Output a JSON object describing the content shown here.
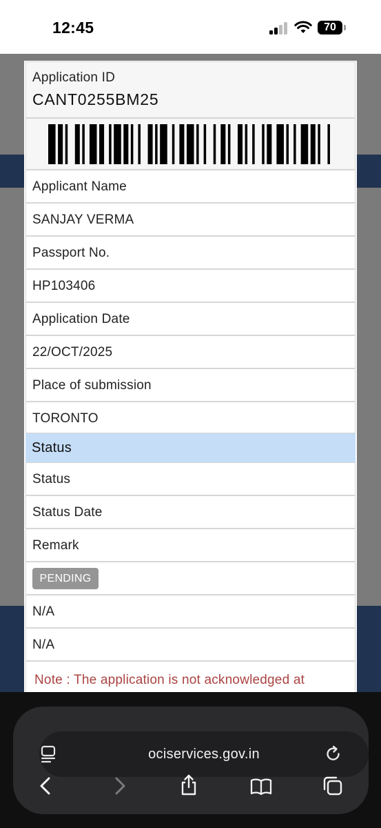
{
  "status_bar": {
    "time": "12:45",
    "battery": "70",
    "icons": [
      "cellular-signal-icon",
      "wifi-icon",
      "battery-icon"
    ]
  },
  "application": {
    "id_label": "Application ID",
    "id_value": "CANT0255BM25",
    "rows": [
      {
        "label": "Applicant Name",
        "value": "SANJAY VERMA"
      },
      {
        "label": "Passport No.",
        "value": "HP103406"
      },
      {
        "label": "Application Date",
        "value": "22/OCT/2025"
      },
      {
        "label": "Place of submission",
        "value": "TORONTO"
      }
    ]
  },
  "status_section": {
    "heading": "Status",
    "labels": [
      "Status",
      "Status Date",
      "Remark"
    ],
    "status_badge": "PENDING",
    "status_date": "N/A",
    "remark": "N/A"
  },
  "note": "Note : The application is not acknowledged at",
  "browser": {
    "url": "ociservices.gov.in",
    "toolbar_icons": [
      "page-menu-icon",
      "reload-icon",
      "back-icon",
      "forward-icon",
      "share-icon",
      "bookmarks-icon",
      "tabs-icon"
    ]
  },
  "colors": {
    "status_header_bg": "#c5ddf7",
    "badge_bg": "#959595",
    "note_text": "#a94442",
    "backdrop_band": "#203350"
  }
}
